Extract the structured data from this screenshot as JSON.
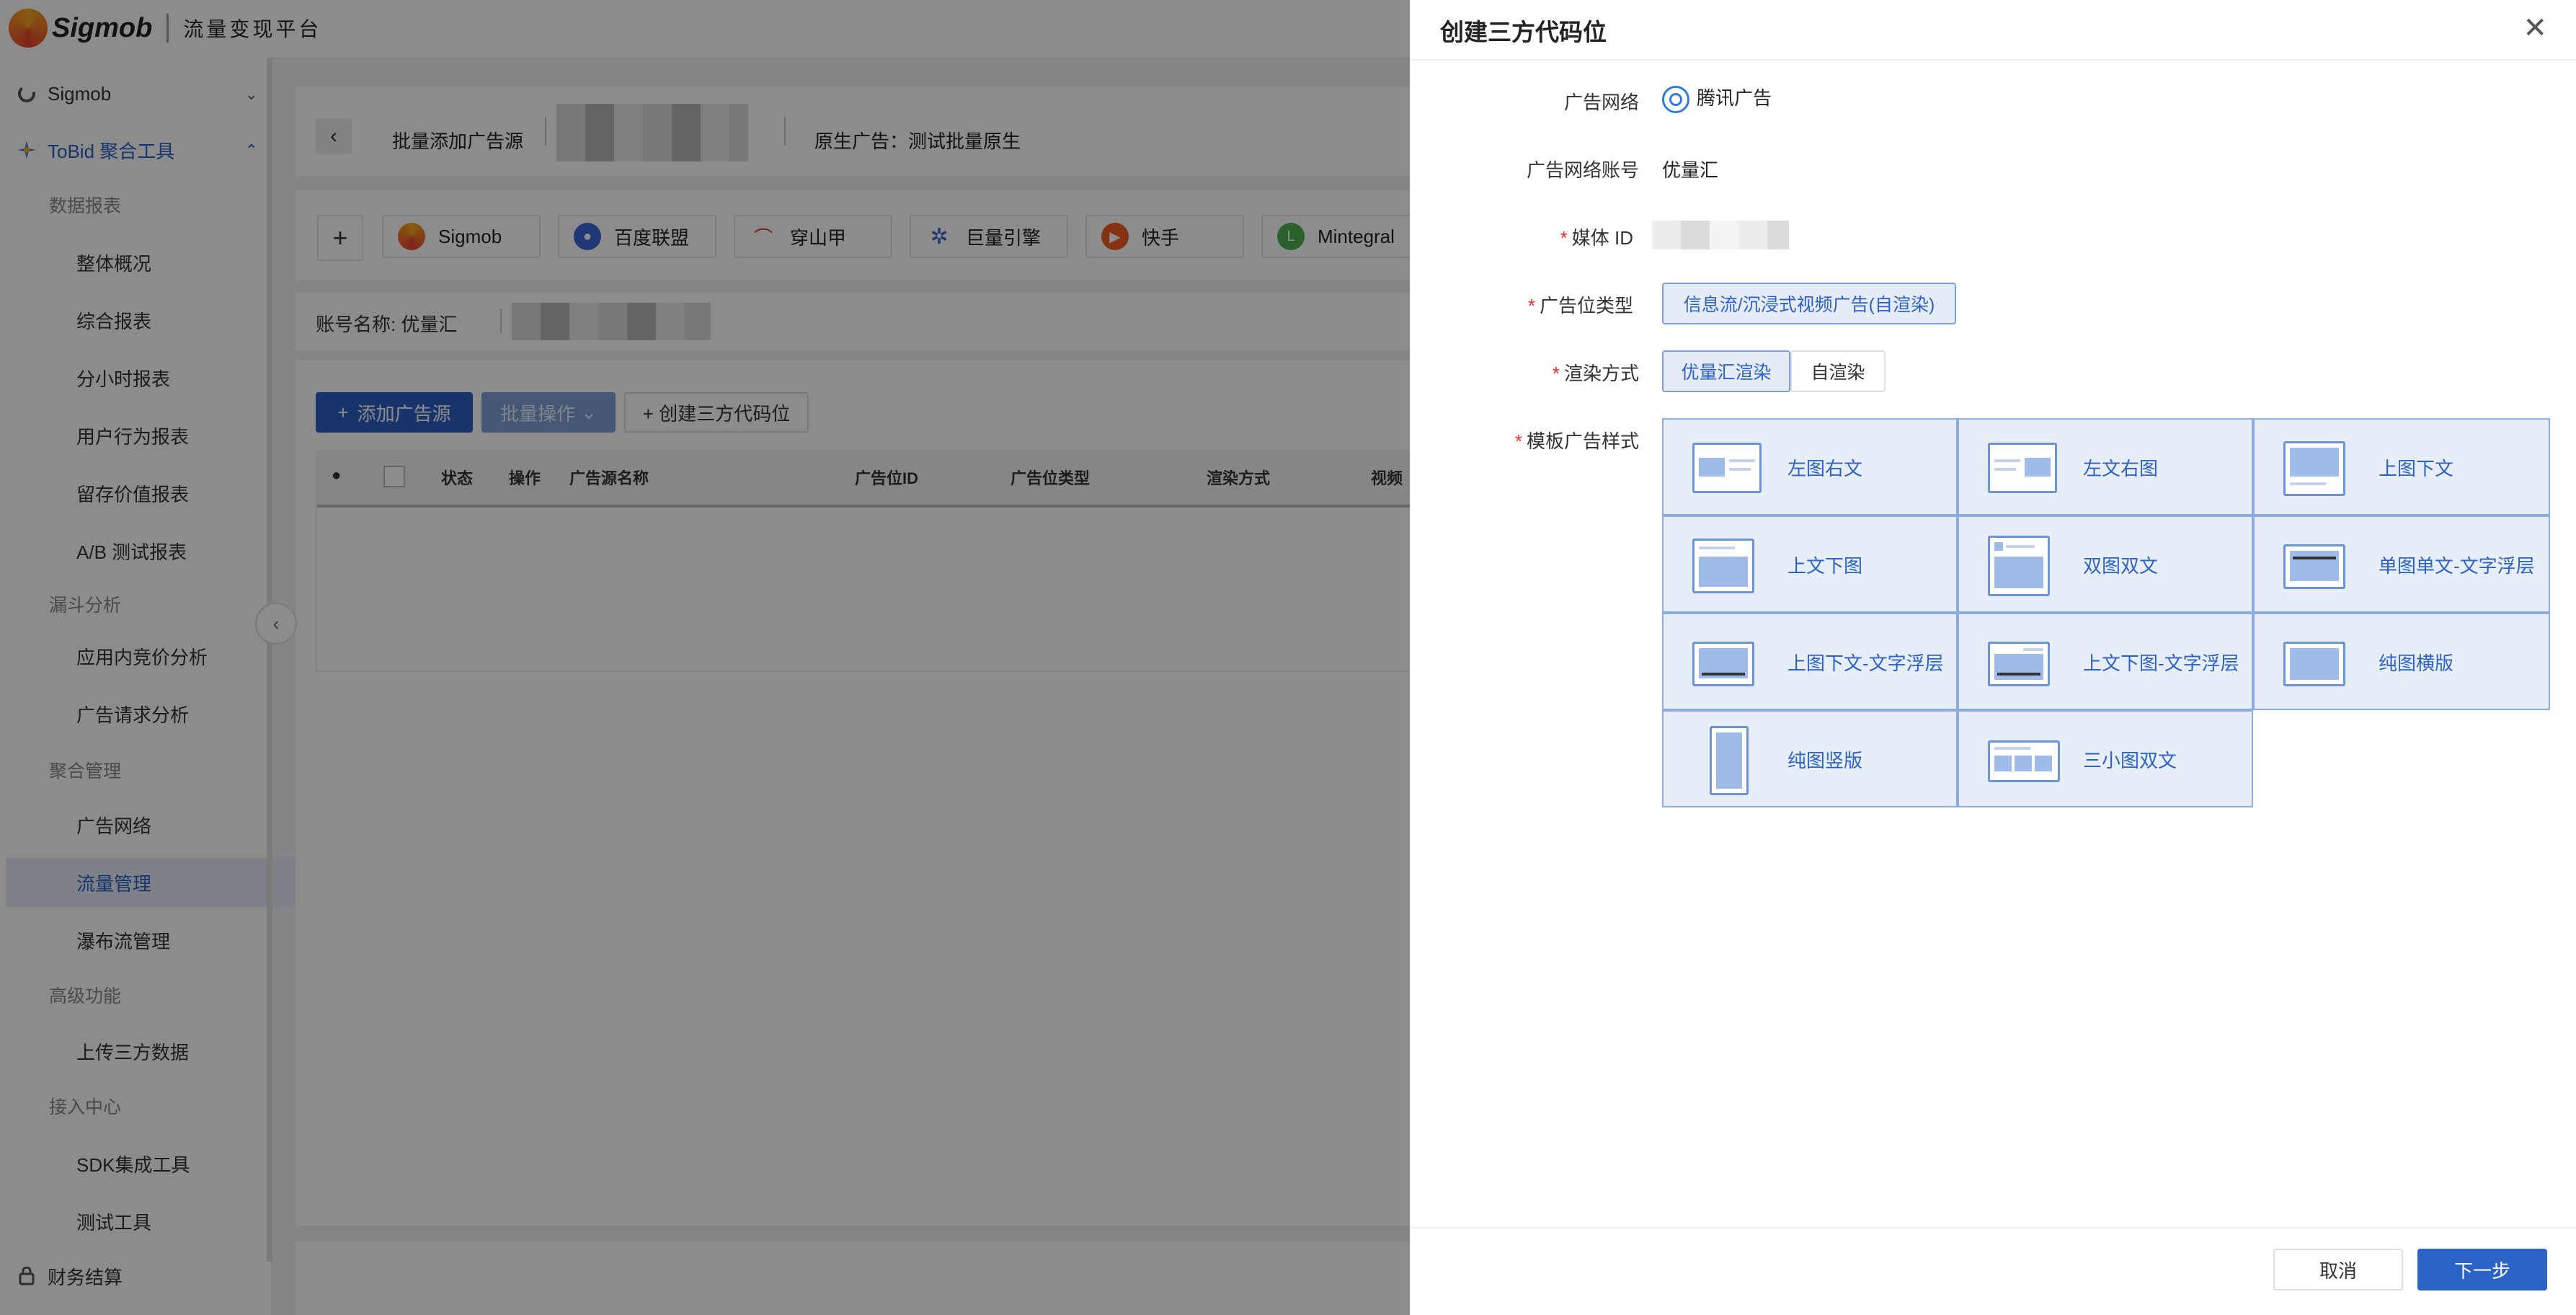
{
  "app": {
    "brand": "Sigmob",
    "platform": "流量变现平台"
  },
  "sidebar": {
    "sigmob": "Sigmob",
    "tobid": "ToBid 聚合工具",
    "groups": {
      "data_report": "数据报表",
      "funnel": "漏斗分析",
      "mediation": "聚合管理",
      "advanced": "高级功能",
      "access": "接入中心"
    },
    "items": {
      "overview": "整体概况",
      "composite": "综合报表",
      "hourly": "分小时报表",
      "behavior": "用户行为报表",
      "retention": "留存价值报表",
      "ab": "A/B 测试报表",
      "inapp": "应用内竞价分析",
      "adrequest": "广告请求分析",
      "adnetwork": "广告网络",
      "traffic": "流量管理",
      "waterfall": "瀑布流管理",
      "upload": "上传三方数据",
      "sdk": "SDK集成工具",
      "test": "测试工具",
      "finance": "财务结算"
    }
  },
  "main": {
    "breadcrumb_title": "批量添加广告源",
    "native_ad": "原生广告：测试批量原生",
    "tabs": [
      "Sigmob",
      "百度联盟",
      "穿山甲",
      "巨量引擎",
      "快手",
      "Mintegral"
    ],
    "account_label": "账号名称: 优量汇",
    "add_source": "添加广告源",
    "batch_ops": "批量操作",
    "create_third": "+ 创建三方代码位",
    "columns": [
      "状态",
      "操作",
      "广告源名称",
      "广告位ID",
      "广告位类型",
      "渲染方式",
      "视频"
    ]
  },
  "drawer": {
    "title": "创建三方代码位",
    "fields": {
      "ad_network_label": "广告网络",
      "ad_network_value": "腾讯广告",
      "ad_account_label": "广告网络账号",
      "ad_account_value": "优量汇",
      "media_id_label": "媒体 ID",
      "slot_type_label": "广告位类型",
      "slot_type_value": "信息流/沉浸式视频广告(自渲染)",
      "render_label": "渲染方式",
      "render_options": [
        "优量汇渲染",
        "自渲染"
      ],
      "template_label": "模板广告样式"
    },
    "templates": [
      "左图右文",
      "左文右图",
      "上图下文",
      "上文下图",
      "双图双文",
      "单图单文-文字浮层",
      "上图下文-文字浮层",
      "上文下图-文字浮层",
      "纯图横版",
      "纯图竖版",
      "三小图双文"
    ],
    "cancel": "取消",
    "next": "下一步"
  },
  "colors": {
    "primary": "#2b62c4",
    "selected_bg": "#e6ecf7",
    "required": "#e0322f"
  }
}
